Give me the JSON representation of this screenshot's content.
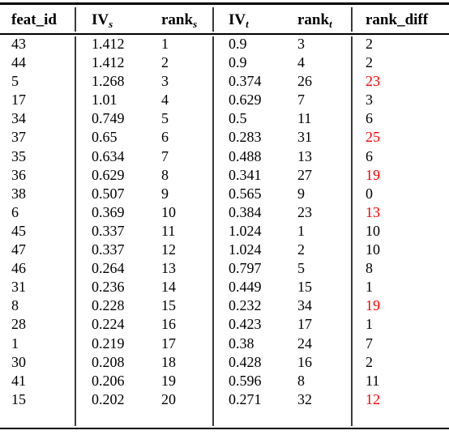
{
  "table": {
    "columns": [
      {
        "key": "feat_id",
        "label": "feat_id",
        "sub": ""
      },
      {
        "key": "iv_s",
        "label": "IV",
        "sub": "s"
      },
      {
        "key": "rank_s",
        "label": "rank",
        "sub": "s"
      },
      {
        "key": "iv_t",
        "label": "IV",
        "sub": "t"
      },
      {
        "key": "rank_t",
        "label": "rank",
        "sub": "t"
      },
      {
        "key": "rank_diff",
        "label": "rank_diff",
        "sub": ""
      }
    ],
    "highlight_color": "#ff0000",
    "rows": [
      {
        "feat_id": "43",
        "iv_s": "1.412",
        "rank_s": "1",
        "iv_t": "0.9",
        "rank_t": "3",
        "rank_diff": "2",
        "highlight": false
      },
      {
        "feat_id": "44",
        "iv_s": "1.412",
        "rank_s": "2",
        "iv_t": "0.9",
        "rank_t": "4",
        "rank_diff": "2",
        "highlight": false
      },
      {
        "feat_id": "5",
        "iv_s": "1.268",
        "rank_s": "3",
        "iv_t": "0.374",
        "rank_t": "26",
        "rank_diff": "23",
        "highlight": true
      },
      {
        "feat_id": "17",
        "iv_s": "1.01",
        "rank_s": "4",
        "iv_t": "0.629",
        "rank_t": "7",
        "rank_diff": "3",
        "highlight": false
      },
      {
        "feat_id": "34",
        "iv_s": "0.749",
        "rank_s": "5",
        "iv_t": "0.5",
        "rank_t": "11",
        "rank_diff": "6",
        "highlight": false
      },
      {
        "feat_id": "37",
        "iv_s": "0.65",
        "rank_s": "6",
        "iv_t": "0.283",
        "rank_t": "31",
        "rank_diff": "25",
        "highlight": true
      },
      {
        "feat_id": "35",
        "iv_s": "0.634",
        "rank_s": "7",
        "iv_t": "0.488",
        "rank_t": "13",
        "rank_diff": "6",
        "highlight": false
      },
      {
        "feat_id": "36",
        "iv_s": "0.629",
        "rank_s": "8",
        "iv_t": "0.341",
        "rank_t": "27",
        "rank_diff": "19",
        "highlight": true
      },
      {
        "feat_id": "38",
        "iv_s": "0.507",
        "rank_s": "9",
        "iv_t": "0.565",
        "rank_t": "9",
        "rank_diff": "0",
        "highlight": false
      },
      {
        "feat_id": "6",
        "iv_s": "0.369",
        "rank_s": "10",
        "iv_t": "0.384",
        "rank_t": "23",
        "rank_diff": "13",
        "highlight": true
      },
      {
        "feat_id": "45",
        "iv_s": "0.337",
        "rank_s": "11",
        "iv_t": "1.024",
        "rank_t": "1",
        "rank_diff": "10",
        "highlight": false
      },
      {
        "feat_id": "47",
        "iv_s": "0.337",
        "rank_s": "12",
        "iv_t": "1.024",
        "rank_t": "2",
        "rank_diff": "10",
        "highlight": false
      },
      {
        "feat_id": "46",
        "iv_s": "0.264",
        "rank_s": "13",
        "iv_t": "0.797",
        "rank_t": "5",
        "rank_diff": "8",
        "highlight": false
      },
      {
        "feat_id": "31",
        "iv_s": "0.236",
        "rank_s": "14",
        "iv_t": "0.449",
        "rank_t": "15",
        "rank_diff": "1",
        "highlight": false
      },
      {
        "feat_id": "8",
        "iv_s": "0.228",
        "rank_s": "15",
        "iv_t": "0.232",
        "rank_t": "34",
        "rank_diff": "19",
        "highlight": true
      },
      {
        "feat_id": "28",
        "iv_s": "0.224",
        "rank_s": "16",
        "iv_t": "0.423",
        "rank_t": "17",
        "rank_diff": "1",
        "highlight": false
      },
      {
        "feat_id": "1",
        "iv_s": "0.219",
        "rank_s": "17",
        "iv_t": "0.38",
        "rank_t": "24",
        "rank_diff": "7",
        "highlight": false
      },
      {
        "feat_id": "30",
        "iv_s": "0.208",
        "rank_s": "18",
        "iv_t": "0.428",
        "rank_t": "16",
        "rank_diff": "2",
        "highlight": false
      },
      {
        "feat_id": "41",
        "iv_s": "0.206",
        "rank_s": "19",
        "iv_t": "0.596",
        "rank_t": "8",
        "rank_diff": "11",
        "highlight": false
      },
      {
        "feat_id": "15",
        "iv_s": "0.202",
        "rank_s": "20",
        "iv_t": "0.271",
        "rank_t": "32",
        "rank_diff": "12",
        "highlight": true
      }
    ]
  }
}
